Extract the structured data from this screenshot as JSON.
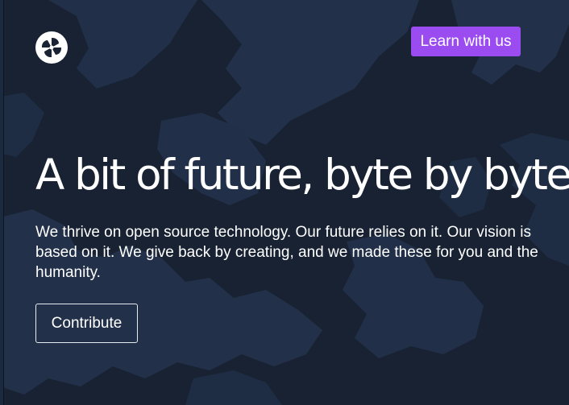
{
  "header": {
    "logo_icon": "pinwheel-logo-icon",
    "learn_label": "Learn with us"
  },
  "hero": {
    "headline": "A bit of future, byte by byte",
    "description": "We thrive on open source technology. Our future relies on it. Our vision is based on it. We give back by creating, and we made these for you and the humanity.",
    "contribute_label": "Contribute"
  },
  "colors": {
    "background": "#182233",
    "map_pattern": "#213048",
    "accent": "#9a4cf0",
    "text": "#ffffff"
  }
}
